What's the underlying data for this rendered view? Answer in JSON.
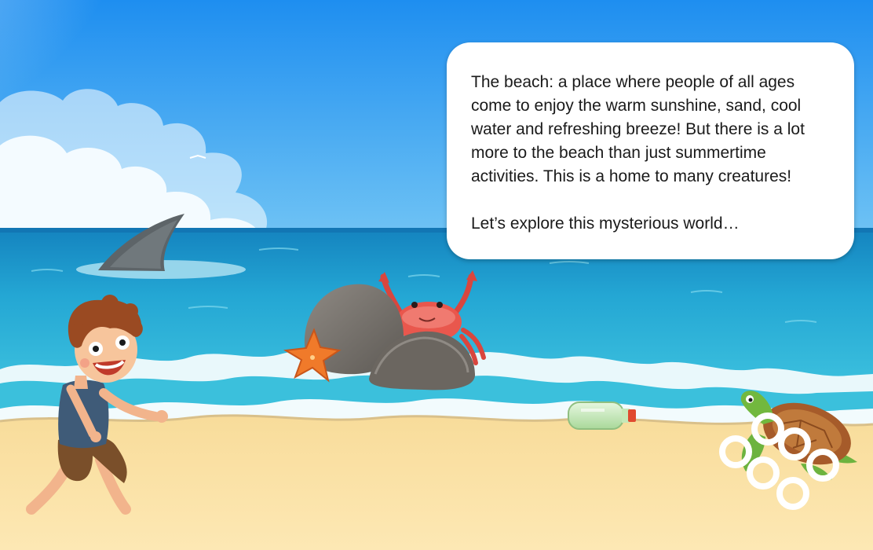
{
  "story": {
    "paragraph_1": "The beach: a place where people of all ages come to enjoy the warm sunshine, sand, cool water and refreshing breeze! But there is a lot more to the beach than just summertime activities. This is a home to many creatures!",
    "paragraph_2": "Let’s explore this mysterious world…"
  },
  "colors": {
    "sky_top": "#1e8ef0",
    "sky_bottom": "#6fc3f4",
    "sea_far": "#1a88c6",
    "sea_near": "#3cc3df",
    "sand": "#fbe3a6",
    "speech_bubble": "#ffffff"
  },
  "scene_objects": [
    "shark-fin",
    "boy",
    "rocks",
    "crab",
    "starfish",
    "plastic-bottle",
    "sea-turtle",
    "plastic-six-pack-rings",
    "clouds",
    "seagull"
  ]
}
